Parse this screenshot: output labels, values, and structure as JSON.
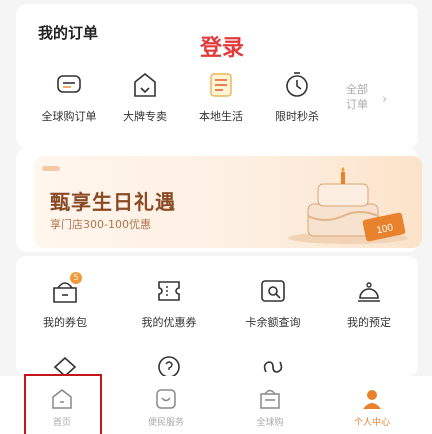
{
  "orders": {
    "title": "我的订单",
    "login": "登录",
    "items": [
      {
        "icon": "cart-icon",
        "label": "全球购订单"
      },
      {
        "icon": "brand-shop-icon",
        "label": "大牌专卖"
      },
      {
        "icon": "food-icon",
        "label": "本地生活"
      },
      {
        "icon": "timer-icon",
        "label": "限时秒杀"
      }
    ],
    "all_orders": "全部订单"
  },
  "banner": {
    "title": "甄享生日礼遇",
    "subtitle": "享门店300-100优惠",
    "coupon_text": "100"
  },
  "services": {
    "items": [
      {
        "icon": "membership-icon",
        "label": "我的券包",
        "badge": "5"
      },
      {
        "icon": "coupon-icon",
        "label": "我的优惠券"
      },
      {
        "icon": "product-query-icon",
        "label": "卡余额查询"
      },
      {
        "icon": "reservation-icon",
        "label": "我的预定"
      },
      {
        "icon": "diamond-icon",
        "label": ""
      },
      {
        "icon": "help-icon",
        "label": ""
      },
      {
        "icon": "infinity-icon",
        "label": ""
      }
    ]
  },
  "tabbar": {
    "items": [
      {
        "icon": "home-icon",
        "label": "首页",
        "active": false
      },
      {
        "icon": "convenience-icon",
        "label": "便民服务",
        "active": false
      },
      {
        "icon": "global-buy-icon",
        "label": "全球购",
        "active": false
      },
      {
        "icon": "person-icon",
        "label": "个人中心",
        "active": true
      }
    ]
  },
  "colors": {
    "accent": "#e8822c",
    "login_red": "#e23b3b",
    "highlight_border": "#c4161c"
  }
}
